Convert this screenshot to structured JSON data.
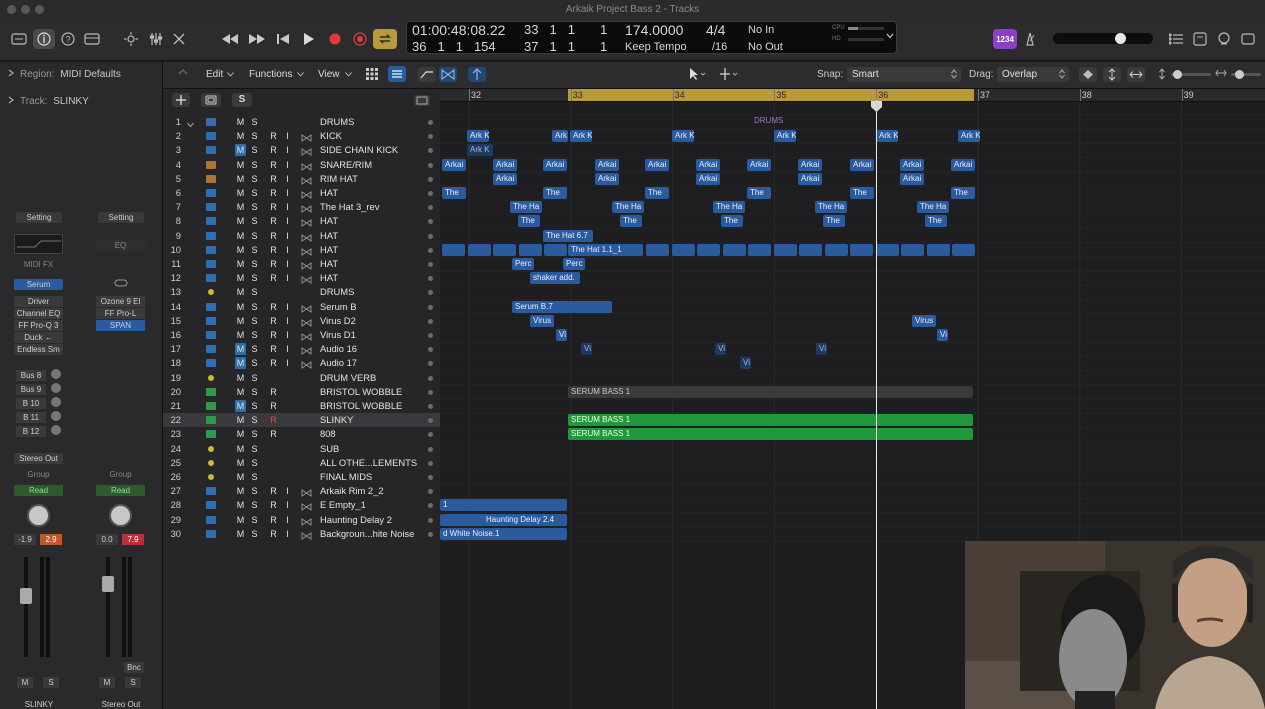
{
  "window": {
    "title": "Arkaik Project Bass 2 - Tracks"
  },
  "lcd": {
    "time": "01:00:48:08.22",
    "bars_top": [
      "33",
      "1",
      "1",
      "1"
    ],
    "bars_bottom": [
      "36",
      "1",
      "1",
      "154"
    ],
    "bars_bottom2": [
      "37",
      "1",
      "1",
      "1"
    ],
    "tempo": "174.0000",
    "tempo_mode": "Keep Tempo",
    "sig_top": "4/4",
    "sig_bottom": "/16",
    "midi_in": "No In",
    "midi_out": "No Out",
    "cpu_label": "CPU",
    "hd_label": "HD"
  },
  "controlbar": {
    "badge": "1234"
  },
  "inspector": {
    "region_label": "Region:",
    "region_value": "MIDI Defaults",
    "track_label": "Track:",
    "track_value": "SLINKY",
    "strip1": {
      "setting": "Setting",
      "midi_fx": "MIDI FX",
      "instrument": "Serum",
      "plugins": [
        "Driver",
        "Channel EQ",
        "FF Pro-Q 3",
        "Duck ←",
        "Endless Sm"
      ],
      "sends": [
        "Bus 8",
        "Bus 9",
        "B 10",
        "B 11",
        "B 12"
      ],
      "output": "Stereo Out",
      "group": "Group",
      "automation": "Read",
      "pan_value": "-1.9",
      "gain_value": "2.9",
      "mute": "M",
      "solo": "S",
      "name": "SLINKY"
    },
    "strip2": {
      "setting": "Setting",
      "eq": "EQ",
      "plugins": [
        "Ozone 9 El",
        "FF Pro-L",
        "SPAN"
      ],
      "group": "Group",
      "automation": "Read",
      "pan_value": "0.0",
      "gain_value": "7.9",
      "bounce": "Bnc",
      "mute": "M",
      "solo": "S",
      "name": "Stereo Out"
    }
  },
  "toolbar": {
    "edit": "Edit",
    "functions": "Functions",
    "view": "View",
    "snap_label": "Snap:",
    "snap_value": "Smart",
    "drag_label": "Drag:",
    "drag_value": "Overlap"
  },
  "track_header_buttons": {
    "mute": "M",
    "solo": "S",
    "record": "R",
    "input": "I"
  },
  "tracks": [
    {
      "num": "1",
      "name": "DRUMS",
      "icon": "folder-icon",
      "r": false,
      "i": false
    },
    {
      "num": "2",
      "name": "KICK",
      "icon": "audio-icon",
      "r": true,
      "i": true
    },
    {
      "num": "3",
      "name": "SIDE CHAIN KICK",
      "icon": "audio-icon",
      "r": true,
      "i": true
    },
    {
      "num": "4",
      "name": "SNARE/RIM",
      "icon": "drum-machine-icon",
      "r": true,
      "i": true
    },
    {
      "num": "5",
      "name": "RIM HAT",
      "icon": "drum-machine-icon",
      "r": true,
      "i": true
    },
    {
      "num": "6",
      "name": "HAT",
      "icon": "audio-icon",
      "r": true,
      "i": true
    },
    {
      "num": "7",
      "name": "The Hat 3_rev",
      "icon": "audio-icon",
      "r": true,
      "i": true
    },
    {
      "num": "8",
      "name": "HAT",
      "icon": "audio-icon",
      "r": true,
      "i": true
    },
    {
      "num": "9",
      "name": "HAT",
      "icon": "audio-icon",
      "r": true,
      "i": true
    },
    {
      "num": "10",
      "name": "HAT",
      "icon": "audio-icon",
      "r": true,
      "i": true
    },
    {
      "num": "11",
      "name": "HAT",
      "icon": "audio-icon",
      "r": true,
      "i": true
    },
    {
      "num": "12",
      "name": "HAT",
      "icon": "audio-icon",
      "r": true,
      "i": true
    },
    {
      "num": "13",
      "name": "DRUMS",
      "icon": "aux-icon",
      "r": false,
      "i": false
    },
    {
      "num": "14",
      "name": "Serum B",
      "icon": "audio-icon",
      "r": true,
      "i": true
    },
    {
      "num": "15",
      "name": "Virus D2",
      "icon": "audio-icon",
      "r": true,
      "i": true
    },
    {
      "num": "16",
      "name": "Virus D1",
      "icon": "audio-icon",
      "r": true,
      "i": true
    },
    {
      "num": "17",
      "name": "Audio 16",
      "icon": "audio-icon",
      "r": true,
      "i": true
    },
    {
      "num": "18",
      "name": "Audio 17",
      "icon": "audio-icon",
      "r": true,
      "i": true
    },
    {
      "num": "19",
      "name": "DRUM VERB",
      "icon": "aux-icon",
      "r": false,
      "i": false
    },
    {
      "num": "20",
      "name": "BRISTOL WOBBLE",
      "icon": "synth-icon",
      "r": true,
      "i": false
    },
    {
      "num": "21",
      "name": "BRISTOL WOBBLE",
      "icon": "synth-icon",
      "r": true,
      "i": false
    },
    {
      "num": "22",
      "name": "SLINKY",
      "icon": "synth-icon",
      "r": true,
      "i": false
    },
    {
      "num": "23",
      "name": "808",
      "icon": "synth-icon",
      "r": true,
      "i": false
    },
    {
      "num": "24",
      "name": "SUB",
      "icon": "aux-icon",
      "r": false,
      "i": false
    },
    {
      "num": "25",
      "name": "ALL OTHE...LEMENTS",
      "icon": "aux-icon",
      "r": false,
      "i": false
    },
    {
      "num": "26",
      "name": "FINAL MIDS",
      "icon": "aux-icon",
      "r": false,
      "i": false
    },
    {
      "num": "27",
      "name": "Arkaik Rim 2_2",
      "icon": "audio-icon",
      "r": true,
      "i": true
    },
    {
      "num": "28",
      "name": "E Empty_1",
      "icon": "audio-icon",
      "r": true,
      "i": true
    },
    {
      "num": "29",
      "name": "Haunting Delay 2",
      "icon": "audio-icon",
      "r": true,
      "i": true
    },
    {
      "num": "30",
      "name": "Backgroun...hite Noise",
      "icon": "audio-icon",
      "r": true,
      "i": true
    }
  ],
  "ruler": {
    "bars": [
      "32",
      "33",
      "34",
      "35",
      "36",
      "37",
      "38",
      "39"
    ]
  },
  "regions": {
    "drums_folder": "DRUMS",
    "kick": "Ark K",
    "side_chain": "Ark K",
    "snare": "Arkai",
    "rim": "Arkai",
    "hat": "The",
    "hat_rev": "The Ha",
    "hat8": "The",
    "hat9": "The Hat 6.7",
    "hat10": "The Hat 1.1_1",
    "perc": "Perc",
    "shaker": "shaker add.",
    "serum": "Serum B.7",
    "virus": "Virus",
    "vi": "Vi",
    "serum_bass": "SERUM BASS 1",
    "e_empty": "1",
    "haunting": "Haunting Delay 2.4",
    "noise": "d White Noise.1"
  },
  "colors": {
    "accent_blue": "#2a5b9e",
    "accent_green": "#1f9a3a",
    "cycle_yellow": "#b89a3a",
    "record_red": "#e03a3a"
  }
}
